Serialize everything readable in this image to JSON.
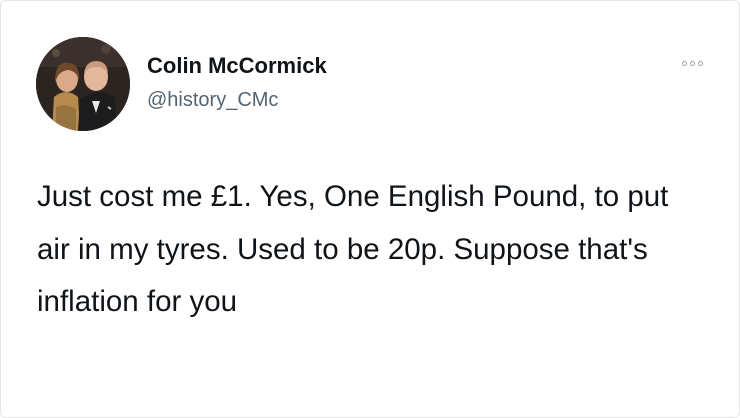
{
  "author": {
    "display_name": "Colin McCormick",
    "handle": "@history_CMc"
  },
  "more_icon": "more-horizontal-icon",
  "tweet": {
    "text": "Just cost me £1. Yes, One English Pound, to put air in my tyres. Used to be 20p. Suppose that's inflation for you"
  }
}
